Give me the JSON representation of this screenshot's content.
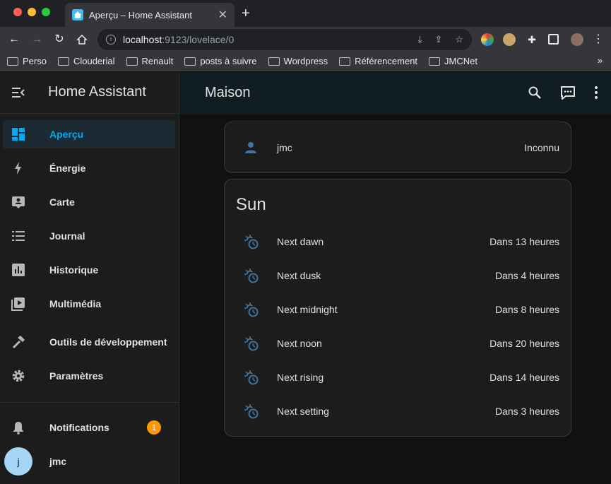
{
  "browser": {
    "tab_title": "Aperçu – Home Assistant",
    "url_host": "localhost",
    "url_rest": ":9123/lovelace/0",
    "bookmarks": [
      "Perso",
      "Clouderial",
      "Renault",
      "posts à suivre",
      "Wordpress",
      "Référencement",
      "JMCNet"
    ],
    "bookmarks_more": "»"
  },
  "sidebar": {
    "app_title": "Home Assistant",
    "items": [
      {
        "label": "Aperçu",
        "icon": "dashboard-icon"
      },
      {
        "label": "Énergie",
        "icon": "lightning-icon"
      },
      {
        "label": "Carte",
        "icon": "map-account-icon"
      },
      {
        "label": "Journal",
        "icon": "list-icon"
      },
      {
        "label": "Historique",
        "icon": "chart-box-icon"
      },
      {
        "label": "Multimédia",
        "icon": "play-box-icon"
      },
      {
        "label": "Outils de développement",
        "icon": "hammer-icon"
      },
      {
        "label": "Paramètres",
        "icon": "cog-icon"
      }
    ],
    "notifications_label": "Notifications",
    "notifications_count": "1",
    "user_initial": "j",
    "user_name": "jmc"
  },
  "header": {
    "title": "Maison"
  },
  "person_card": {
    "name": "jmc",
    "state": "Inconnu"
  },
  "sun_card": {
    "title": "Sun",
    "rows": [
      {
        "name": "Next dawn",
        "value": "Dans 13 heures"
      },
      {
        "name": "Next dusk",
        "value": "Dans 4 heures"
      },
      {
        "name": "Next midnight",
        "value": "Dans 8 heures"
      },
      {
        "name": "Next noon",
        "value": "Dans 20 heures"
      },
      {
        "name": "Next rising",
        "value": "Dans 14 heures"
      },
      {
        "name": "Next setting",
        "value": "Dans 3 heures"
      }
    ]
  },
  "colors": {
    "accent": "#03a9f4",
    "icon": "#44739e",
    "badge": "#ff9800"
  }
}
